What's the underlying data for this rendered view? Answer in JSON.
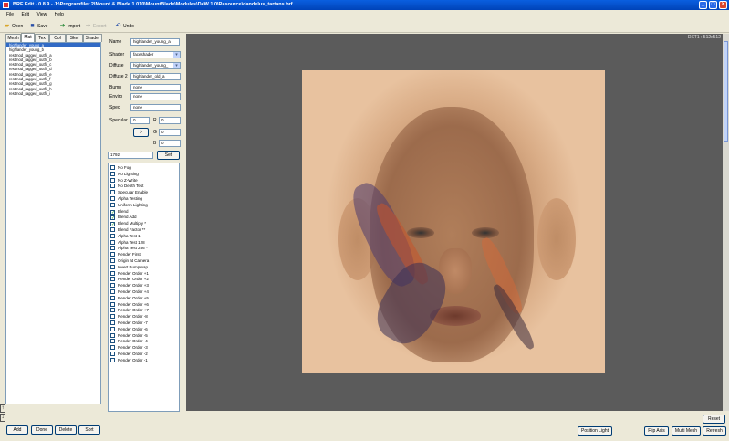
{
  "window": {
    "title": "BRF Edit - 0.8.9 - J:\\Programfiler 2\\Mount & Blade 1.010\\MountBlade\\Modules\\DeW 1.0\\Resource\\dandelus_tartans.brf",
    "buttons": [
      "_",
      "□",
      "×"
    ]
  },
  "menu": [
    "File",
    "Edit",
    "View",
    "Help"
  ],
  "toolbar": {
    "open": "Open",
    "save": "Save",
    "import": "Import",
    "export": "Export",
    "undo": "Undo"
  },
  "tabs": [
    "Mesh",
    "Mat",
    "Tex",
    "Col",
    "Skel",
    "Shader"
  ],
  "active_tab": "Mat",
  "materials": [
    "highlander_young_a",
    "highlander_young_b",
    "restmod_ragged_outfit_a",
    "restmod_ragged_outfit_b",
    "restmod_ragged_outfit_c",
    "restmod_ragged_outfit_d",
    "restmod_ragged_outfit_e",
    "restmod_ragged_outfit_f",
    "restmod_ragged_outfit_g",
    "restmod_ragged_outfit_h",
    "restmod_ragged_outfit_i"
  ],
  "selected_material": 0,
  "props": {
    "name_label": "Name",
    "name": "highlander_young_a",
    "shader_label": "Shader",
    "shader": "faceshader",
    "diffuse_label": "Diffuse",
    "diffuse": "highlander_young_",
    "diffuse2_label": "Diffuse 2",
    "diffuse2": "highlander_old_a",
    "bump_label": "Bump",
    "bump": "none",
    "enviro_label": "Enviro",
    "enviro": "none",
    "spec_label": "Spec",
    "spec": "none",
    "specular_label": "Specular",
    "specular": "0",
    "r_label": "R",
    "r": "0",
    "g_label": "G",
    "g": "0",
    "b_label": "B",
    "b": "0",
    "arrow_label": ">",
    "flags_value": "1792",
    "set_label": "Set"
  },
  "flags": [
    {
      "label": "No Fog",
      "checked": false
    },
    {
      "label": "No Lighting",
      "checked": false
    },
    {
      "label": "No Z-Write",
      "checked": false
    },
    {
      "label": "No Depth Test",
      "checked": false
    },
    {
      "label": "Specular Enable",
      "checked": false
    },
    {
      "label": "Alpha Testing",
      "checked": false
    },
    {
      "label": "Uniform Lighting",
      "checked": false
    },
    {
      "label": "Blend",
      "checked": true
    },
    {
      "label": "Blend Add",
      "checked": true
    },
    {
      "label": "Blend Multiply *",
      "checked": true
    },
    {
      "label": "Blend Factor **",
      "checked": false
    },
    {
      "label": "Alpha Test 1",
      "checked": false
    },
    {
      "label": "Alpha Test 128",
      "checked": false
    },
    {
      "label": "Alpha Test 256 *",
      "checked": false
    },
    {
      "label": "Render First",
      "checked": false
    },
    {
      "label": "Origin at Camera",
      "checked": false
    },
    {
      "label": "Invert Bumpmap",
      "checked": false
    },
    {
      "label": "Render Order +1",
      "checked": false
    },
    {
      "label": "Render Order +2",
      "checked": false
    },
    {
      "label": "Render Order +3",
      "checked": false
    },
    {
      "label": "Render Order +4",
      "checked": false
    },
    {
      "label": "Render Order +5",
      "checked": false
    },
    {
      "label": "Render Order +6",
      "checked": false
    },
    {
      "label": "Render Order +7",
      "checked": false
    },
    {
      "label": "Render Order -8",
      "checked": false
    },
    {
      "label": "Render Order -7",
      "checked": false
    },
    {
      "label": "Render Order -6",
      "checked": false
    },
    {
      "label": "Render Order -5",
      "checked": false
    },
    {
      "label": "Render Order -4",
      "checked": false
    },
    {
      "label": "Render Order -3",
      "checked": false
    },
    {
      "label": "Render Order -2",
      "checked": false
    },
    {
      "label": "Render Order -1",
      "checked": false
    }
  ],
  "viewport": {
    "info": "DXT1 : 512x512",
    "reset": "Reset"
  },
  "bottom": {
    "add": "Add",
    "done": "Done",
    "delete": "Delete",
    "sort": "Sort",
    "position_light": "Position Light",
    "flip_axis": "Flip Axis",
    "multi_mesh": "Multi Mesh",
    "refresh": "Refresh"
  },
  "colors": {
    "titlebar": "#0a5fe0",
    "selection": "#316ac5",
    "viewport_bg": "#5b5b5b",
    "window_bg": "#ece9d8"
  }
}
